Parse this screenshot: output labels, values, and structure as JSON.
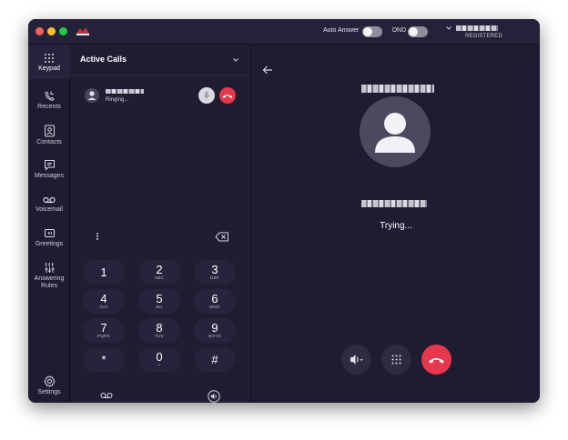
{
  "titlebar": {
    "auto_answer_label": "Auto Answer",
    "dnd_label": "DND",
    "status": "REGISTERED"
  },
  "sidebar": {
    "items": [
      {
        "label": "Keypad",
        "icon": "keypad-icon"
      },
      {
        "label": "Recents",
        "icon": "recents-icon"
      },
      {
        "label": "Contacts",
        "icon": "contacts-icon"
      },
      {
        "label": "Messages",
        "icon": "messages-icon"
      },
      {
        "label": "Voicemail",
        "icon": "voicemail-icon"
      },
      {
        "label": "Greetings",
        "icon": "greetings-icon"
      },
      {
        "label": "Answering Rules",
        "icon": "answering-rules-icon"
      }
    ],
    "settings_label": "Settings"
  },
  "calls": {
    "title": "Active Calls",
    "call_status": "Ringing..."
  },
  "keypad": {
    "keys": [
      {
        "digit": "1",
        "letters": ""
      },
      {
        "digit": "2",
        "letters": "ABC"
      },
      {
        "digit": "3",
        "letters": "DEF"
      },
      {
        "digit": "4",
        "letters": "GHI"
      },
      {
        "digit": "5",
        "letters": "JKL"
      },
      {
        "digit": "6",
        "letters": "MNO"
      },
      {
        "digit": "7",
        "letters": "PQRS"
      },
      {
        "digit": "8",
        "letters": "TUV"
      },
      {
        "digit": "9",
        "letters": "WXYZ"
      },
      {
        "digit": "*",
        "letters": ""
      },
      {
        "digit": "0",
        "letters": "+"
      },
      {
        "digit": "#",
        "letters": ""
      }
    ]
  },
  "detail": {
    "call_state": "Trying..."
  },
  "colors": {
    "background": "#1d1c30",
    "key_background": "#25243c",
    "end_call": "#e5384c"
  }
}
